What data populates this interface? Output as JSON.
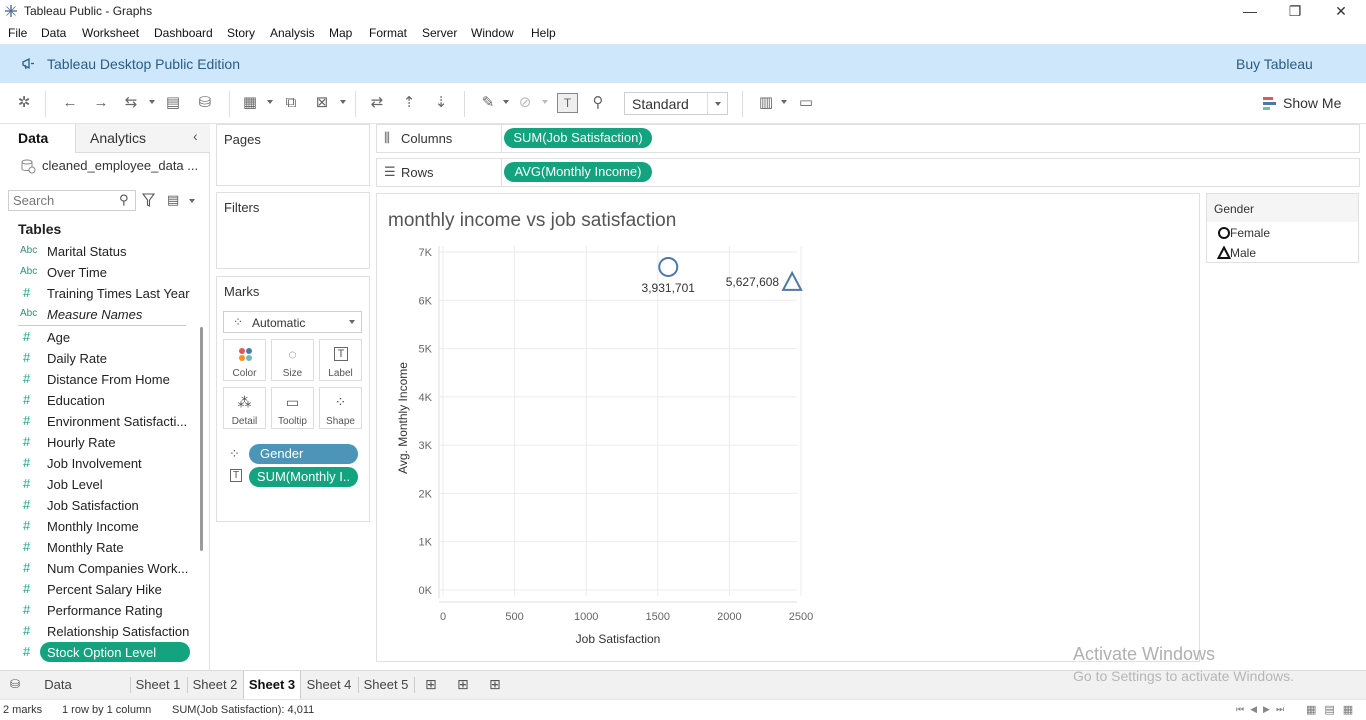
{
  "window": {
    "title": "Tableau Public - Graphs",
    "controls": [
      "—",
      "❐",
      "✕"
    ]
  },
  "menu": [
    "File",
    "Data",
    "Worksheet",
    "Dashboard",
    "Story",
    "Analysis",
    "Map",
    "Format",
    "Server",
    "Window",
    "Help"
  ],
  "banner": {
    "text": "Tableau Desktop Public Edition",
    "buy": "Buy Tableau"
  },
  "toolbar": {
    "fit": "Standard",
    "show_me": "Show Me"
  },
  "data_pane": {
    "tabs": [
      "Data",
      "Analytics"
    ],
    "datasource": "cleaned_employee_data ...",
    "search_placeholder": "Search",
    "tables_heading": "Tables",
    "dimensions": [
      {
        "type": "Abc",
        "name": "Marital Status"
      },
      {
        "type": "Abc",
        "name": "Over Time"
      },
      {
        "type": "#",
        "name": "Training Times Last Year"
      },
      {
        "type": "Abc",
        "name": "Measure Names"
      }
    ],
    "measures": [
      {
        "type": "#",
        "name": "Age"
      },
      {
        "type": "#",
        "name": "Daily Rate"
      },
      {
        "type": "#",
        "name": "Distance From Home"
      },
      {
        "type": "#",
        "name": "Education"
      },
      {
        "type": "#",
        "name": "Environment Satisfacti..."
      },
      {
        "type": "#",
        "name": "Hourly Rate"
      },
      {
        "type": "#",
        "name": "Job Involvement"
      },
      {
        "type": "#",
        "name": "Job Level"
      },
      {
        "type": "#",
        "name": "Job Satisfaction"
      },
      {
        "type": "#",
        "name": "Monthly Income"
      },
      {
        "type": "#",
        "name": "Monthly Rate"
      },
      {
        "type": "#",
        "name": "Num Companies Work..."
      },
      {
        "type": "#",
        "name": "Percent Salary Hike"
      },
      {
        "type": "#",
        "name": "Performance Rating"
      },
      {
        "type": "#",
        "name": "Relationship Satisfaction"
      },
      {
        "type": "#",
        "name": "Stock Option Level"
      }
    ]
  },
  "cards": {
    "pages": "Pages",
    "filters": "Filters",
    "marks": "Marks",
    "mark_type": "Automatic",
    "mark_buttons": [
      "Color",
      "Size",
      "Label",
      "Detail",
      "Tooltip",
      "Shape"
    ],
    "mark_pills": [
      "Gender",
      "SUM(Monthly I.."
    ]
  },
  "shelves": {
    "columns_label": "Columns",
    "columns_pill": "SUM(Job Satisfaction)",
    "rows_label": "Rows",
    "rows_pill": "AVG(Monthly Income)"
  },
  "chart_data": {
    "type": "scatter",
    "title": "monthly income vs job satisfaction",
    "xlabel": "Job Satisfaction",
    "ylabel": "Avg. Monthly Income",
    "xlim": [
      0,
      2500
    ],
    "ylim": [
      0,
      7000
    ],
    "x_ticks": [
      "0",
      "500",
      "1000",
      "1500",
      "2000",
      "2500"
    ],
    "y_ticks": [
      "0K",
      "1K",
      "2K",
      "3K",
      "4K",
      "5K",
      "6K",
      "7K"
    ],
    "grid": true,
    "series": [
      {
        "name": "Female",
        "shape": "circle",
        "x": 1573,
        "y": 6690,
        "label": "3,931,701"
      },
      {
        "name": "Male",
        "shape": "triangle",
        "x": 2438,
        "y": 6380,
        "label": "5,627,608"
      }
    ],
    "mark_color": "#4e79a7"
  },
  "legend": {
    "title": "Gender",
    "items": [
      {
        "label": "Female",
        "shape": "circle"
      },
      {
        "label": "Male",
        "shape": "triangle"
      }
    ]
  },
  "sheets": {
    "data_source": "Data Source",
    "tabs": [
      "Sheet 1",
      "Sheet 2",
      "Sheet 3",
      "Sheet 4",
      "Sheet 5"
    ],
    "active": "Sheet 3"
  },
  "status": {
    "marks": "2 marks",
    "dims": "1 row by 1 column",
    "sum": "SUM(Job Satisfaction): 4,011"
  },
  "watermark": {
    "line1": "Activate Windows",
    "line2": "Go to Settings to activate Windows."
  }
}
